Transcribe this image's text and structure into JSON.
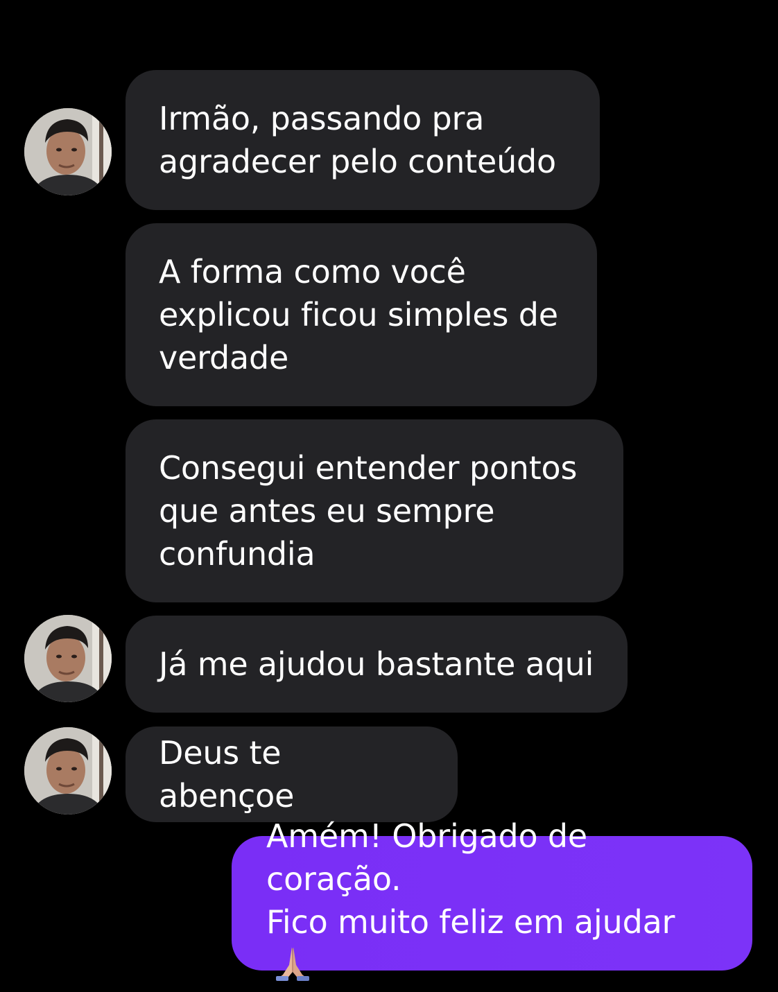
{
  "conversation": {
    "messages": [
      {
        "sender": "contact",
        "text": "Irmão, passando pra\nagradecer pelo conteúdo"
      },
      {
        "sender": "contact",
        "text": "A forma como você\nexplicou ficou simples de\nverdade"
      },
      {
        "sender": "contact",
        "text": "Consegui entender pontos\nque antes eu sempre\nconfundia"
      },
      {
        "sender": "contact",
        "text": "Já me ajudou bastante aqui"
      },
      {
        "sender": "contact",
        "text": "Deus te abençoe"
      },
      {
        "sender": "me",
        "text": "Amém! Obrigado de coração.\nFico muito feliz em ajudar",
        "emoji": "folded-hands-emoji"
      }
    ]
  },
  "colors": {
    "background": "#000000",
    "incoming_bubble": "#232326",
    "outgoing_bubble": "#7b2ff7",
    "text": "#ffffff"
  },
  "icons": {
    "avatar": "contact-avatar-photo",
    "emoji": "folded-hands-emoji"
  }
}
